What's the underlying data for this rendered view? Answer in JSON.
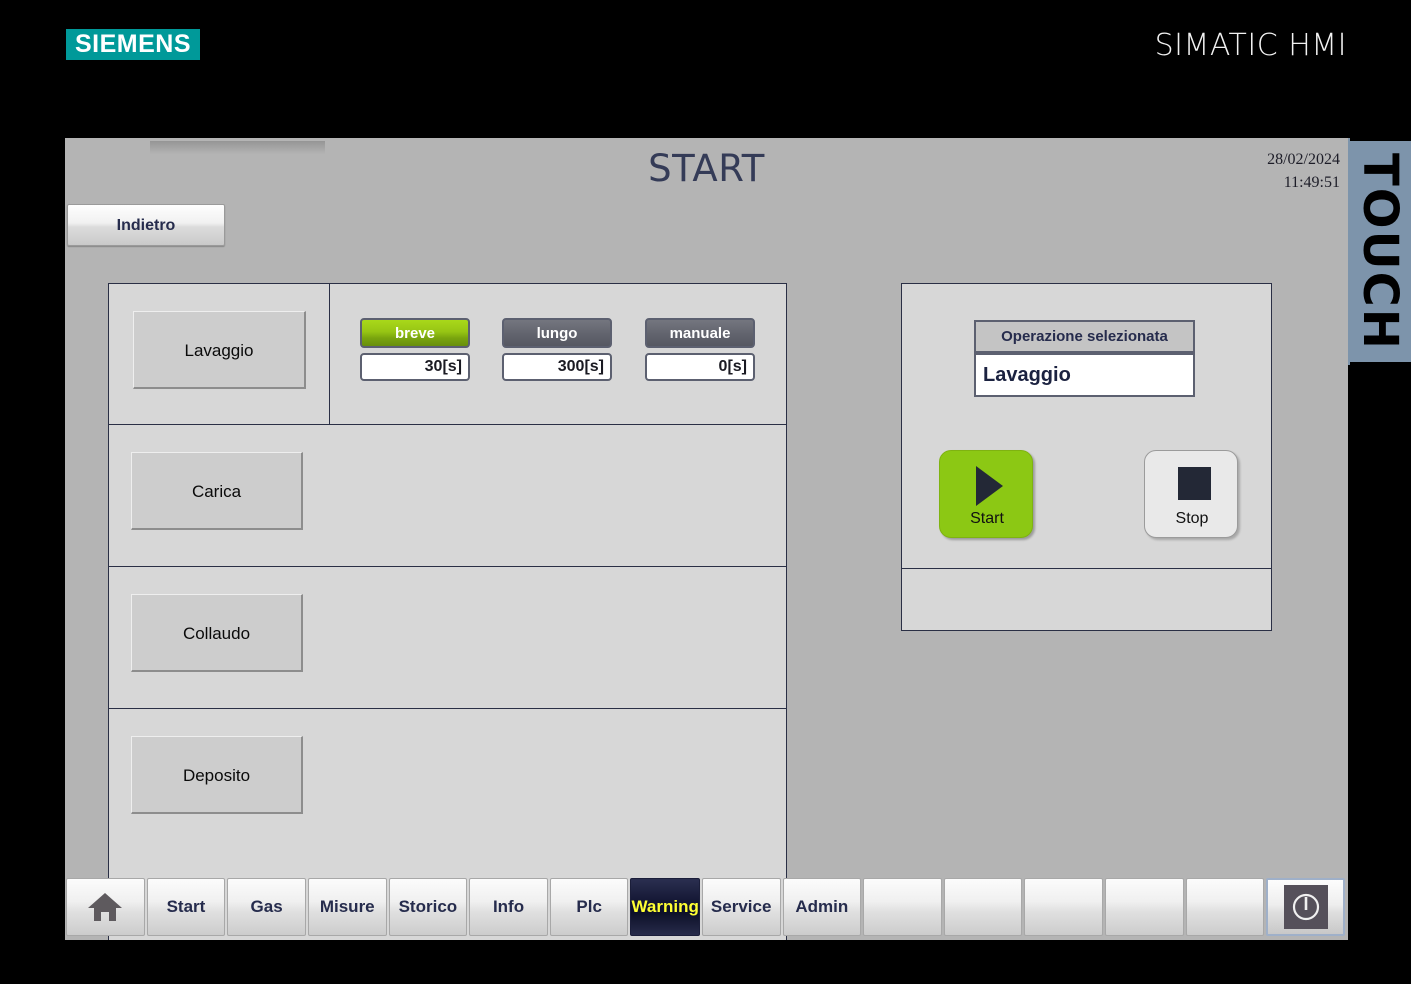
{
  "brand": {
    "logo_text": "SIEMENS",
    "logo_color": "#009999",
    "product_label": "SIMATIC HMI",
    "side_label": "TOUCH",
    "side_label_bg": "#7d94ab"
  },
  "header": {
    "title": "START",
    "title_color": "#343b57",
    "date": "28/02/2024",
    "time": "11:49:51"
  },
  "toolbar": {
    "back_label": "Indietro"
  },
  "operations": {
    "rows": [
      {
        "name": "Lavaggio",
        "modes": [
          {
            "label": "breve",
            "value": "30[s]",
            "active": true
          },
          {
            "label": "lungo",
            "value": "300[s]",
            "active": false
          },
          {
            "label": "manuale",
            "value": "0[s]",
            "active": false
          }
        ]
      },
      {
        "name": "Carica",
        "modes": []
      },
      {
        "name": "Collaudo",
        "modes": []
      },
      {
        "name": "Deposito",
        "modes": []
      }
    ]
  },
  "selection": {
    "header_label": "Operazione selezionata",
    "selected_operation": "Lavaggio",
    "start_label": "Start",
    "stop_label": "Stop",
    "start_color": "#8cc814",
    "stop_color": "#e9e9e9"
  },
  "navigation": {
    "items": [
      {
        "label": "",
        "icon": "home-icon",
        "style": "home"
      },
      {
        "label": "Start",
        "icon": "",
        "style": "lbl"
      },
      {
        "label": "Gas",
        "icon": "",
        "style": "lbl"
      },
      {
        "label": "Misure",
        "icon": "",
        "style": "lbl"
      },
      {
        "label": "Storico",
        "icon": "",
        "style": "lbl"
      },
      {
        "label": "Info",
        "icon": "",
        "style": "lbl"
      },
      {
        "label": "Plc",
        "icon": "",
        "style": "lbl"
      },
      {
        "label": "Warning",
        "icon": "",
        "style": "warning"
      },
      {
        "label": "Service",
        "icon": "",
        "style": "lbl"
      },
      {
        "label": "Admin",
        "icon": "",
        "style": "lbl"
      },
      {
        "label": "",
        "icon": "",
        "style": "blank"
      },
      {
        "label": "",
        "icon": "",
        "style": "blank"
      },
      {
        "label": "",
        "icon": "",
        "style": "blank"
      },
      {
        "label": "",
        "icon": "",
        "style": "blank"
      },
      {
        "label": "",
        "icon": "",
        "style": "blank"
      },
      {
        "label": "",
        "icon": "power-icon",
        "style": "power"
      }
    ],
    "warning_text_color": "#ffff33"
  }
}
